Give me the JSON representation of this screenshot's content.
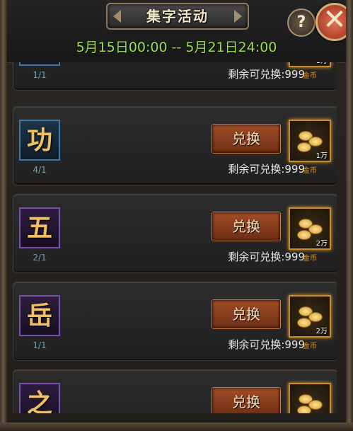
{
  "header": {
    "title": "集字活动",
    "help_label": "?",
    "close_label": "✕",
    "date_range": "5月15日00:00 -- 5月21日24:00"
  },
  "rows": [
    {
      "char": "",
      "count": "1/1",
      "button": "",
      "remaining": "剩余可兑换:999",
      "gold_amount": "1万",
      "gold_label": "金币",
      "border": "blue"
    },
    {
      "char": "功",
      "count": "4/1",
      "button": "兑换",
      "remaining": "剩余可兑换:999",
      "gold_amount": "1万",
      "gold_label": "金币",
      "border": "blue"
    },
    {
      "char": "五",
      "count": "2/1",
      "button": "兑换",
      "remaining": "剩余可兑换:999",
      "gold_amount": "2万",
      "gold_label": "金币",
      "border": "purple"
    },
    {
      "char": "岳",
      "count": "1/1",
      "button": "兑换",
      "remaining": "剩余可兑换:999",
      "gold_amount": "2万",
      "gold_label": "金币",
      "border": "purple"
    },
    {
      "char": "之",
      "count": "",
      "button": "兑换",
      "remaining": "",
      "gold_amount": "",
      "gold_label": "",
      "border": "purple"
    }
  ],
  "colors": {
    "date_text": "#9ee04a",
    "button": "#8a3d1c",
    "count_text": "#6fa0b8"
  }
}
